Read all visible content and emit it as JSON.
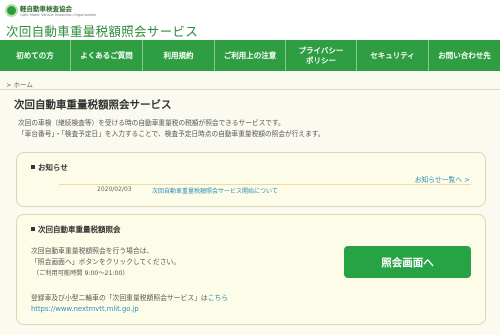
{
  "header": {
    "logo_jp": "軽自動車検査協会",
    "logo_en": "Light Motor Vehicle Inspection Organization",
    "site_title": "次回自動車重量税額照会サービス"
  },
  "nav": {
    "items": [
      {
        "label": "初めての方"
      },
      {
        "label": "よくあるご質問"
      },
      {
        "label": "利用規約"
      },
      {
        "label": "ご利用上の注意"
      },
      {
        "label": "プライバシー\nポリシー"
      },
      {
        "label": "セキュリティ"
      },
      {
        "label": "お問い合わせ先"
      }
    ]
  },
  "breadcrumb": "> ホーム",
  "main": {
    "title": "次回自動車重量税額照会サービス",
    "intro_line1": "次回の車検（継続検査等）を受ける時の自動車重量税の税額が照会できるサービスです。",
    "intro_line2": "「車台番号」・「検査予定日」を入力することで、検査予定日時点の自動車重量税額の照会が行えます。"
  },
  "news": {
    "heading": "お知らせ",
    "list_link": "お知らせ一覧へ >",
    "items": [
      {
        "date": "2020/02/03",
        "title": "次回自動車重量税額照会サービス開始について"
      }
    ]
  },
  "inquiry": {
    "heading": "次回自動車重量税額照会",
    "line1": "次回自動車重量税額照会を行う場合は、",
    "line2": "「照会画面へ」ボタンをクリックしてください。",
    "hours": "（ご利用可能時間 9:00～21:00）",
    "button_label": "照会画面へ",
    "note_prefix": "登録車及び小型二輪車の「次回重量税額照会サービス」は",
    "note_link": "こちら",
    "url": "https://www.nextmvtt.mlit.go.jp"
  }
}
